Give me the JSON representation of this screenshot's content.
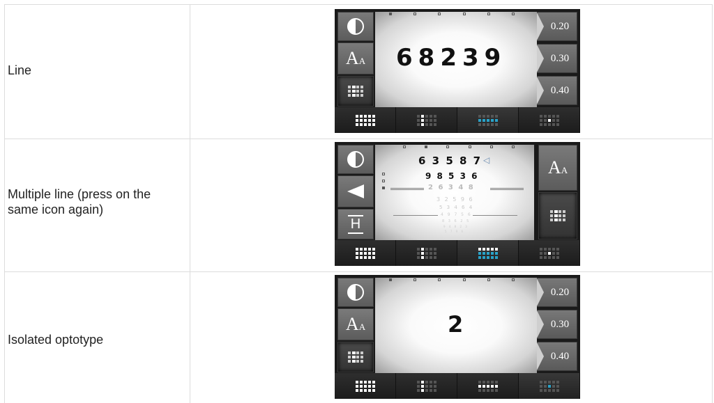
{
  "rows": [
    {
      "label": "Line",
      "optotypes": "68239",
      "acuities": [
        "0.20",
        "0.30",
        "0.40"
      ]
    },
    {
      "label": "Multiple line (press on the same icon again)",
      "lines": [
        "6 3 5 8 7",
        "9 8 5 3 6",
        "2 6 3 4 8",
        "3 2 5 9 6",
        "5 3 4 6 4",
        "4 9 7 5 6",
        "8 3 6 2 5",
        "9 4 8 2 3",
        "5 7 9 6"
      ]
    },
    {
      "label": "Isolated optotype",
      "optotypes": "2",
      "acuities": [
        "0.20",
        "0.30",
        "0.40"
      ]
    }
  ],
  "icons": {
    "contrast": "contrast-icon",
    "size": "text-size-icon",
    "grid": "chart-mode-icon",
    "back": "back-arrow-icon",
    "h": "h-letter-icon"
  },
  "text_size_icon": {
    "big": "A",
    "small": "A"
  },
  "h_icon_label": "H",
  "colors": {
    "accent_blue": "#29a3c9"
  }
}
